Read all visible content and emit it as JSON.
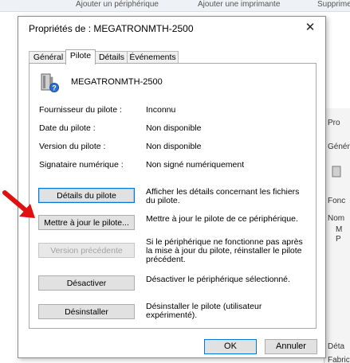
{
  "background": {
    "top_items": [
      "Ajouter un périphérique",
      "Ajouter une imprimante",
      "Supprimer"
    ],
    "right_texts": [
      "Pro",
      "Génér",
      "Fonc",
      "Nom",
      "M",
      "P",
      "Déta",
      "Fabric"
    ]
  },
  "dialog": {
    "title": "Propriétés de : MEGATRONMTH-2500",
    "close_glyph": "✕",
    "tabs": [
      "Général",
      "Pilote",
      "Détails",
      "Événements"
    ],
    "active_tab": "Pilote",
    "device_name": "MEGATRONMTH-2500",
    "info": [
      {
        "label": "Fournisseur du pilote :",
        "value": "Inconnu"
      },
      {
        "label": "Date du pilote :",
        "value": "Non disponible"
      },
      {
        "label": "Version du pilote :",
        "value": "Non disponible"
      },
      {
        "label": "Signataire numérique :",
        "value": "Non signé numériquement"
      }
    ],
    "actions": [
      {
        "button": "Détails du pilote",
        "desc": "Afficher les détails concernant les fichiers du pilote."
      },
      {
        "button": "Mettre à jour le pilote...",
        "desc": "Mettre à jour le pilote de ce périphérique."
      },
      {
        "button": "Version précédente",
        "desc": "Si le périphérique ne fonctionne pas après la mise à jour du pilote, réinstaller le pilote précédent."
      },
      {
        "button": "Désactiver",
        "desc": "Désactiver le périphérique sélectionné."
      },
      {
        "button": "Désinstaller",
        "desc": "Désinstaller le pilote (utilisateur expérimenté)."
      }
    ],
    "ok_label": "OK",
    "cancel_label": "Annuler"
  },
  "colors": {
    "annotation_arrow": "#e01010",
    "focus_border": "#0078d7"
  }
}
